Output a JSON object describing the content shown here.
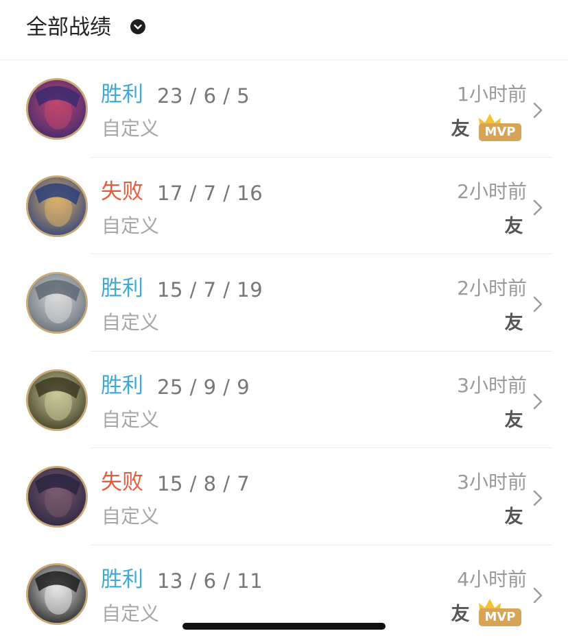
{
  "header": {
    "title": "全部战绩",
    "dropdown_icon": "chevron-down-icon"
  },
  "matches": [
    {
      "result": "胜利",
      "outcome": "win",
      "kda": "23 / 6 / 5",
      "mode": "自定义",
      "time": "1小时前",
      "friend": "友",
      "mvp": "MVP",
      "avatar_colors": [
        "#3b2a6e",
        "#c0466e"
      ]
    },
    {
      "result": "失败",
      "outcome": "lose",
      "kda": "17 / 7 / 16",
      "mode": "自定义",
      "time": "2小时前",
      "friend": "友",
      "mvp": "",
      "avatar_colors": [
        "#2c3f7a",
        "#d9b06a"
      ]
    },
    {
      "result": "胜利",
      "outcome": "win",
      "kda": "15 / 7 / 19",
      "mode": "自定义",
      "time": "2小时前",
      "friend": "友",
      "mvp": "",
      "avatar_colors": [
        "#5f6a74",
        "#d8d8d8"
      ]
    },
    {
      "result": "胜利",
      "outcome": "win",
      "kda": "25 / 9 / 9",
      "mode": "自定义",
      "time": "3小时前",
      "friend": "友",
      "mvp": "",
      "avatar_colors": [
        "#3c3a22",
        "#c9c89a"
      ]
    },
    {
      "result": "失败",
      "outcome": "lose",
      "kda": "15 / 8 / 7",
      "mode": "自定义",
      "time": "3小时前",
      "friend": "友",
      "mvp": "",
      "avatar_colors": [
        "#2a2340",
        "#7a5a6e"
      ]
    },
    {
      "result": "胜利",
      "outcome": "win",
      "kda": "13 / 6 / 11",
      "mode": "自定义",
      "time": "4小时前",
      "friend": "友",
      "mvp": "MVP",
      "avatar_colors": [
        "#1e1e1e",
        "#e6e6e6"
      ]
    }
  ],
  "colors": {
    "win": "#3fa9d6",
    "lose": "#ea5b3c",
    "mvp": "#d6a357",
    "avatar_ring": "#c9a978"
  }
}
